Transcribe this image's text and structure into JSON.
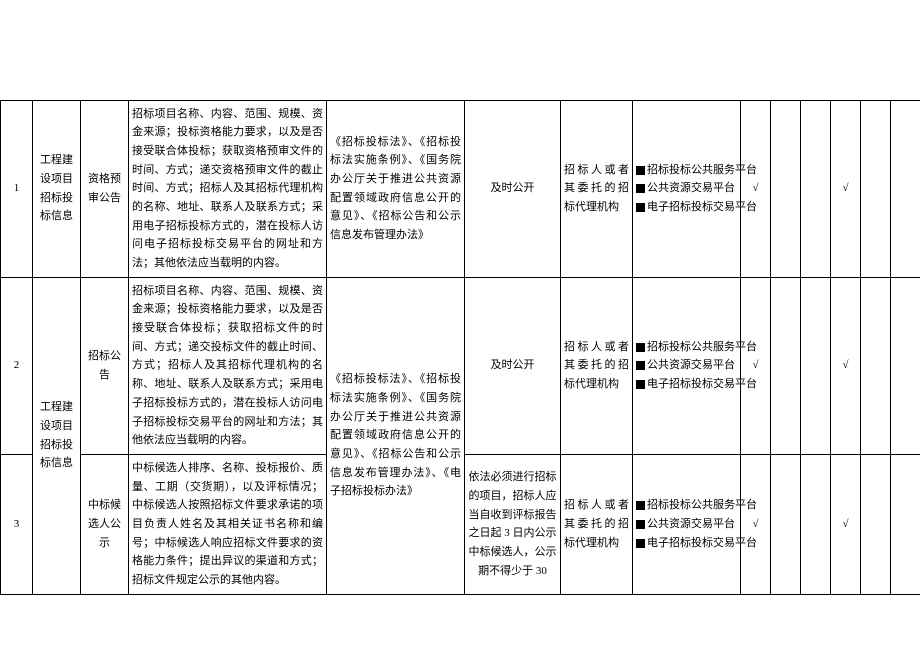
{
  "rows": [
    {
      "num": "1",
      "category": "工程建设项目招标投标信息",
      "type": "资格预审公告",
      "content": "招标项目名称、内容、范围、规模、资金来源；投标资格能力要求，以及是否接受联合体投标；获取资格预审文件的时间、方式；递交资格预审文件的截止时间、方式；招标人及其招标代理机构的名称、地址、联系人及联系方式；采用电子招标投标方式的，潜在投标人访问电子招标投标交易平台的网址和方法；其他依法应当载明的内容。",
      "basis": "《招标投标法》、《招标投标法实施条例》、《国务院办公厅关于推进公共资源配置领域政府信息公开的意见》、《招标公告和公示信息发布管理办法》",
      "time": "及时公开",
      "subject": "招标人或者其委托的招标代理机构",
      "channels": [
        "招标投标公共服务平台",
        "公共资源交易平台",
        "电子招标投标交易平台"
      ],
      "chk1": "√",
      "chk2": "",
      "chk3": "",
      "chk4": "√",
      "chk5": "",
      "chk6": ""
    },
    {
      "num": "2",
      "category": "工程建设项目招标投标信息",
      "type": "招标公告",
      "content": "招标项目名称、内容、范围、规模、资金来源；投标资格能力要求，以及是否接受联合体投标；获取招标文件的时间、方式；递交投标文件的截止时间、方式；招标人及其招标代理机构的名称、地址、联系人及联系方式；采用电子招标投标方式的，潜在投标人访问电子招标投标交易平台的网址和方法；其他依法应当载明的内容。",
      "basis_shared": "《招标投标法》、《招标投标法实施条例》、《国务院办公厅关于推进公共资源配置领域政府信息公开的意见》、《招标公告和公示信息发布管理办法》、《电子招标投标办法》",
      "time": "及时公开",
      "subject": "招标人或者其委托的招标代理机构",
      "channels": [
        "招标投标公共服务平台",
        "公共资源交易平台",
        "电子招标投标交易平台"
      ],
      "chk1": "√",
      "chk2": "",
      "chk3": "",
      "chk4": "√",
      "chk5": "",
      "chk6": ""
    },
    {
      "num": "3",
      "category": "工程建设项目招标投标信息",
      "type": "中标候选人公示",
      "content": "中标候选人排序、名称、投标报价、质量、工期（交货期），以及评标情况；中标候选人按照招标文件要求承诺的项目负责人姓名及其相关证书名称和编号；中标候选人响应招标文件要求的资格能力条件；提出异议的渠道和方式；招标文件规定公示的其他内容。",
      "time": "依法必须进行招标的项目，招标人应当自收到评标报告之日起 3 日内公示中标候选人，公示期不得少于 30",
      "subject": "招标人或者其委托的招标代理机构",
      "channels": [
        "招标投标公共服务平台",
        "公共资源交易平台",
        "电子招标投标交易平台"
      ],
      "chk1": "√",
      "chk2": "",
      "chk3": "",
      "chk4": "√",
      "chk5": "",
      "chk6": ""
    }
  ]
}
